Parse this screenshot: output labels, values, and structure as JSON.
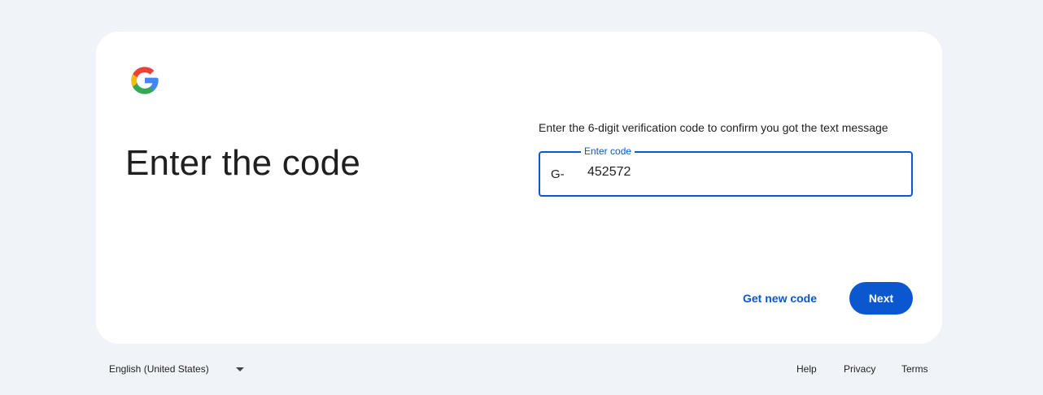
{
  "page": {
    "title": "Enter the code",
    "description": "Enter the 6-digit verification code to confirm you got the text message",
    "logo": "google-g-logo"
  },
  "code_field": {
    "label": "Enter code",
    "prefix": "G-",
    "value": "452572"
  },
  "actions": {
    "get_new_code": "Get new code",
    "next": "Next"
  },
  "footer": {
    "language": "English (United States)",
    "links": [
      "Help",
      "Privacy",
      "Terms"
    ]
  },
  "colors": {
    "accent": "#0b57d0",
    "background": "#f0f4f9"
  }
}
